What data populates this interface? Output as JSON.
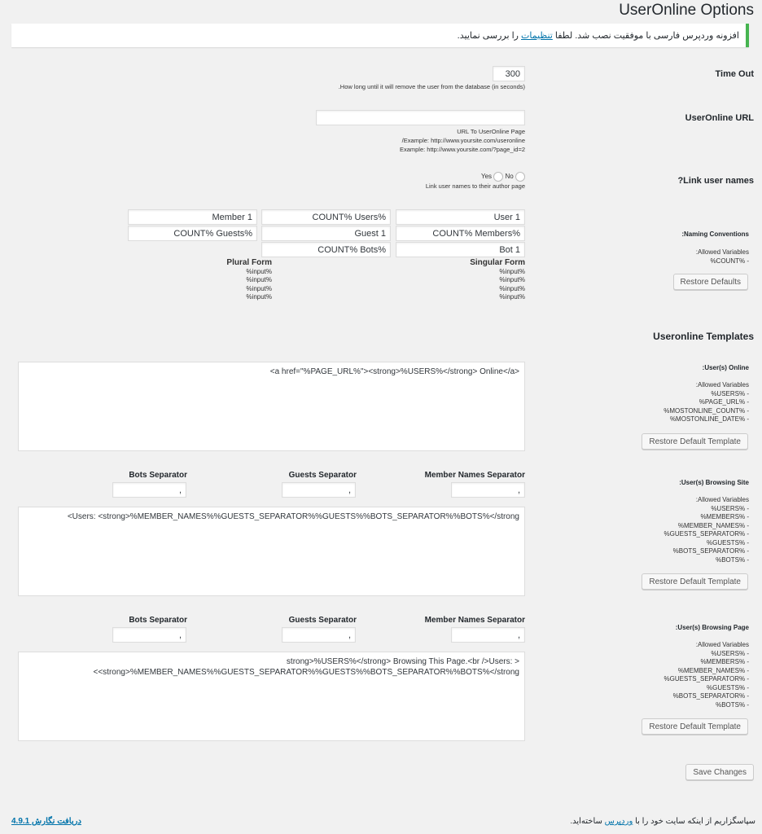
{
  "title": "UserOnline Options",
  "notice": {
    "text_before": "افزونه وردپرس فارسی با موفقیت نصب شد. لطفا ",
    "link": "تنظیمات",
    "text_after": " را بررسی نمایید."
  },
  "timeout": {
    "label": "Time Out",
    "value": "300",
    "desc": ".How long until it will remove the user from the database (in seconds)"
  },
  "url": {
    "label": "UserOnline URL",
    "value": "",
    "desc": [
      "URL To UserOnline Page",
      "/Example: http://www.yoursite.com/useronline",
      "Example: http://www.yoursite.com/?page_id=2"
    ]
  },
  "link_names": {
    "label": "?Link user names",
    "yes": "Yes",
    "no": "No",
    "desc": "Link user names to their author page"
  },
  "naming": {
    "label": ":Naming Conventions",
    "allowed": ":Allowed Variables",
    "vars": [
      "%COUNT% -"
    ],
    "restore": "Restore Defaults",
    "singular_header": "Singular Form",
    "plural_header": "Plural Form",
    "input_placeholder": "%input%",
    "fields": {
      "user_singular": "User 1",
      "users_plural": "COUNT% Users%",
      "member_singular": "Member 1",
      "members_plural": "COUNT% Members%",
      "guest_singular": "Guest 1",
      "guests_plural": "COUNT% Guests%",
      "bot_singular": "Bot 1",
      "bots_plural": "COUNT% Bots%"
    }
  },
  "templates": {
    "heading": "Useronline Templates",
    "online": {
      "label": ":User(s) Online",
      "allowed": ":Allowed Variables",
      "vars": [
        "%USERS% -",
        "%PAGE_URL% -",
        "%MOSTONLINE_COUNT% -",
        "%MOSTONLINE_DATE% -"
      ],
      "restore": "Restore Default Template",
      "value": "<a href=\"%PAGE_URL%\"><strong>%USERS%</strong> Online</a>"
    },
    "browsing_site": {
      "label": ":User(s) Browsing Site",
      "allowed": ":Allowed Variables",
      "vars": [
        "%USERS% -",
        "%MEMBERS% -",
        "%MEMBER_NAMES% -",
        "%GUESTS_SEPARATOR% -",
        "%GUESTS% -",
        "%BOTS_SEPARATOR% -",
        "%BOTS% -"
      ],
      "restore": "Restore Default Template",
      "member_sep_label": "Member Names Separator",
      "guests_sep_label": "Guests Separator",
      "bots_sep_label": "Bots Separator",
      "member_sep": ",",
      "guests_sep": ",",
      "bots_sep": ",",
      "value": "<Users: <strong>%MEMBER_NAMES%%GUESTS_SEPARATOR%%GUESTS%%BOTS_SEPARATOR%%BOTS%</strong"
    },
    "browsing_page": {
      "label": ":User(s) Browsing Page",
      "allowed": ":Allowed Variables",
      "vars": [
        "%USERS% -",
        "%MEMBERS% -",
        "%MEMBER_NAMES% -",
        "%GUESTS_SEPARATOR% -",
        "%GUESTS% -",
        "%BOTS_SEPARATOR% -",
        "%BOTS% -"
      ],
      "restore": "Restore Default Template",
      "member_sep_label": "Member Names Separator",
      "guests_sep_label": "Guests Separator",
      "bots_sep_label": "Bots Separator",
      "member_sep": ",",
      "guests_sep": ",",
      "bots_sep": ",",
      "value": "strong>%USERS%</strong> Browsing This Page.<br />Users: >\n<<strong>%MEMBER_NAMES%%GUESTS_SEPARATOR%%GUESTS%%BOTS_SEPARATOR%%BOTS%</strong"
    }
  },
  "save": "Save Changes",
  "footer": {
    "thanks_before": "سپاسگزاریم از اینکه سایت خود را با ",
    "thanks_link": "وردپرس",
    "thanks_after": " ساخته‌اید.",
    "version": "دریافت نگارش 4.9.1"
  },
  "colors": {
    "accent": "#0073aa",
    "notice_border": "#46b450",
    "background": "#f1f1f1"
  }
}
